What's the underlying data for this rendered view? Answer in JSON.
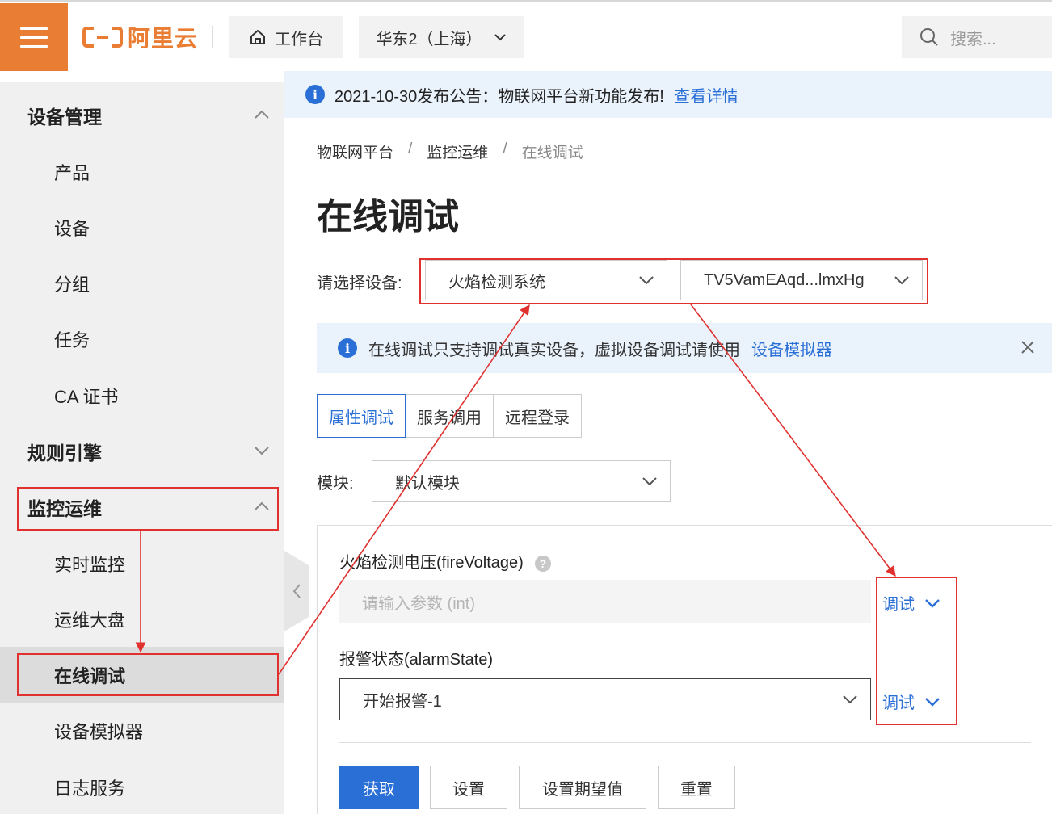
{
  "topbar": {
    "logo_text": "阿里云",
    "workspace_label": "工作台",
    "region_label": "华东2（上海）",
    "search_placeholder": "搜索..."
  },
  "sidebar": {
    "groups": [
      {
        "label": "设备管理",
        "expanded": true,
        "items": [
          "产品",
          "设备",
          "分组",
          "任务",
          "CA 证书"
        ]
      },
      {
        "label": "规则引擎",
        "expanded": false,
        "items": []
      },
      {
        "label": "监控运维",
        "expanded": true,
        "items": [
          "实时监控",
          "运维大盘",
          "在线调试",
          "设备模拟器",
          "日志服务"
        ]
      }
    ],
    "active_item": "在线调试"
  },
  "announcement": {
    "text": "2021-10-30发布公告：物联网平台新功能发布!",
    "link": "查看详情"
  },
  "breadcrumb": [
    "物联网平台",
    "监控运维",
    "在线调试"
  ],
  "breadcrumb_sep": "/",
  "page_title": "在线调试",
  "device_select": {
    "label": "请选择设备:",
    "product": "火焰检测系统",
    "device": "TV5VamEAqd...lmxHg"
  },
  "tip": {
    "text": "在线调试只支持调试真实设备，虚拟设备调试请使用",
    "link": "设备模拟器"
  },
  "tabs": [
    "属性调试",
    "服务调用",
    "远程登录"
  ],
  "active_tab": "属性调试",
  "module": {
    "label": "模块:",
    "value": "默认模块"
  },
  "properties": [
    {
      "label": "火焰检测电压(fireVoltage)",
      "placeholder": "请输入参数 (int)",
      "action": "调试"
    },
    {
      "label": "报警状态(alarmState)",
      "value": "开始报警-1",
      "action": "调试"
    }
  ],
  "buttons": {
    "fetch": "获取",
    "set": "设置",
    "set_expected": "设置期望值",
    "reset": "重置"
  },
  "colors": {
    "brand": "#ea7d34",
    "primary": "#2a6fd6",
    "annotation": "#e0312f"
  }
}
